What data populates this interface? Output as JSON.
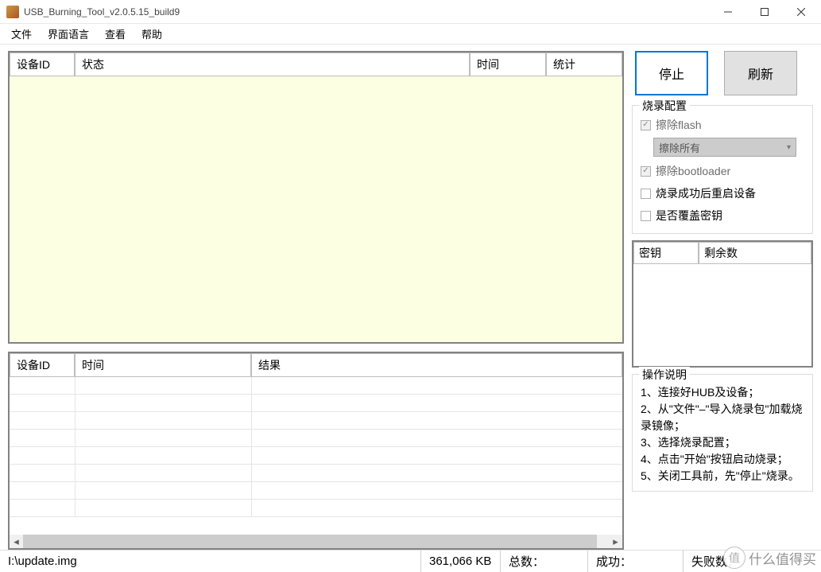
{
  "window": {
    "title": "USB_Burning_Tool_v2.0.5.15_build9"
  },
  "menu": {
    "file": "文件",
    "language": "界面语言",
    "view": "查看",
    "help": "帮助"
  },
  "table1": {
    "headers": {
      "device_id": "设备ID",
      "status": "状态",
      "time": "时间",
      "stats": "统计"
    }
  },
  "table2": {
    "headers": {
      "device_id": "设备ID",
      "time": "时间",
      "result": "结果"
    }
  },
  "buttons": {
    "stop": "停止",
    "refresh": "刷新"
  },
  "burn_config": {
    "legend": "烧录配置",
    "erase_flash": "擦除flash",
    "erase_mode": "擦除所有",
    "erase_bootloader": "擦除bootloader",
    "reboot_after": "烧录成功后重启设备",
    "overwrite_key": "是否覆盖密钥"
  },
  "key_table": {
    "headers": {
      "key": "密钥",
      "remaining": "剩余数"
    }
  },
  "instructions": {
    "legend": "操作说明",
    "l1": "1、连接好HUB及设备；",
    "l2": "2、从\"文件\"–\"导入烧录包\"加载烧录镜像；",
    "l3": "3、选择烧录配置；",
    "l4": "4、点击\"开始\"按钮启动烧录；",
    "l5": "5、关闭工具前，先\"停止\"烧录。"
  },
  "statusbar": {
    "path": "I:\\update.img",
    "size": "361,066 KB",
    "total_label": "总数：",
    "success_label": "成功：",
    "fail_label": "失败数："
  },
  "watermark": "什么值得买"
}
